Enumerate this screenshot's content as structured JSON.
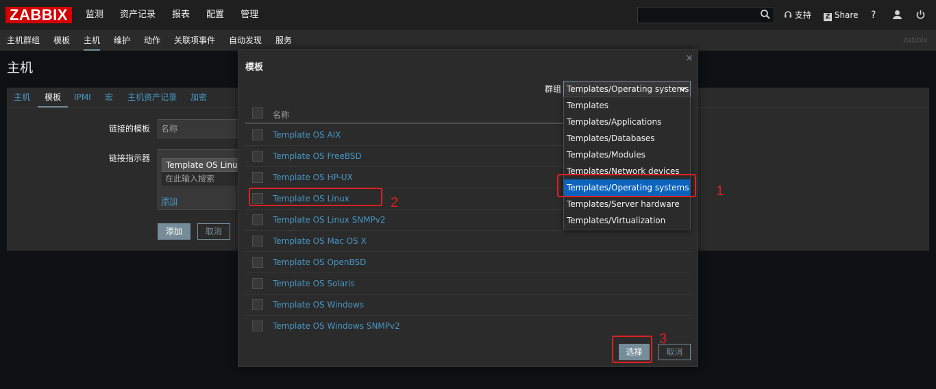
{
  "header": {
    "logo": "ZABBIX",
    "menu": [
      "监测",
      "资产记录",
      "报表",
      "配置",
      "管理"
    ],
    "support": "支持",
    "share": "Share",
    "help": "?"
  },
  "submenu": {
    "items": [
      "主机群组",
      "模板",
      "主机",
      "维护",
      "动作",
      "关联项事件",
      "自动发现",
      "服务"
    ],
    "active": "主机",
    "brand": "zabbix"
  },
  "page": {
    "title": "主机",
    "tabs": [
      "主机",
      "模板",
      "IPMI",
      "宏",
      "主机资产记录",
      "加密"
    ],
    "active_tab": "模板",
    "linked_templates_label": "链接的模板",
    "linked_templates_placeholder": "名称",
    "link_indicator_label": "链接指示器",
    "chip_value": "Template OS Linux",
    "search_placeholder": "在此输入搜索",
    "add_link": "添加",
    "add_button": "添加",
    "cancel_button": "取消"
  },
  "modal": {
    "title": "模板",
    "close": "×",
    "group_label": "群组",
    "group_selected": "Templates/Operating systems",
    "column_name": "名称",
    "templates": [
      "Template OS AIX",
      "Template OS FreeBSD",
      "Template OS HP-UX",
      "Template OS Linux",
      "Template OS Linux SNMPv2",
      "Template OS Mac OS X",
      "Template OS OpenBSD",
      "Template OS Solaris",
      "Template OS Windows",
      "Template OS Windows SNMPv2"
    ],
    "select_button": "选择",
    "cancel_button": "取消"
  },
  "dropdown": {
    "options": [
      "Templates",
      "Templates/Applications",
      "Templates/Databases",
      "Templates/Modules",
      "Templates/Network devices",
      "Templates/Operating systems",
      "Templates/Server hardware",
      "Templates/Virtualization"
    ],
    "selected_index": 5
  },
  "annotations": [
    "1",
    "2",
    "3"
  ],
  "colors": {
    "logo_bg": "#d40000",
    "link": "#4796c4",
    "accent": "#768d99",
    "selected": "#0b63bd",
    "annotation": "#e02020"
  }
}
